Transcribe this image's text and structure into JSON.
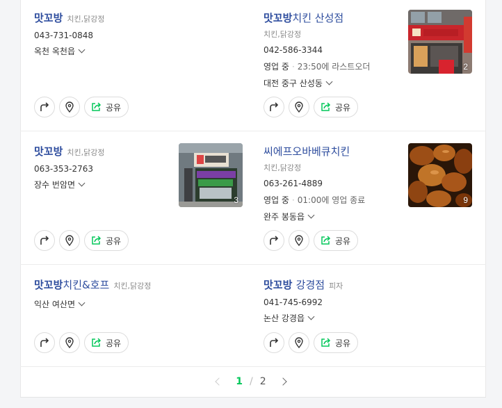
{
  "results": [
    {
      "name": "맛꼬방",
      "name_sub": "",
      "category": "치킨,닭강정",
      "phone": "043-731-0848",
      "status": "",
      "last_order": "",
      "address": "옥천 옥천읍",
      "photo_count": ""
    },
    {
      "name": "맛꼬방",
      "name_sub": "치킨 산성점",
      "category": "치킨,닭강정",
      "phone": "042-586-3344",
      "status": "영업 중",
      "last_order": "23:50에 라스트오더",
      "address": "대전 중구 산성동",
      "photo_count": "2"
    },
    {
      "name": "맛꼬방",
      "name_sub": "",
      "category": "치킨,닭강정",
      "phone": "063-353-2763",
      "status": "",
      "last_order": "",
      "address": "장수 번암면",
      "photo_count": "3"
    },
    {
      "name": "씨에프오바베큐치킨",
      "name_sub": "",
      "category": "치킨,닭강정",
      "phone": "063-261-4889",
      "status": "영업 중",
      "last_order": "01:00에 영업 종료",
      "address": "완주 봉동읍",
      "photo_count": "9"
    },
    {
      "name": "맛꼬방",
      "name_sub": "치킨&호프",
      "category": "치킨,닭강정",
      "phone": "",
      "status": "",
      "last_order": "",
      "address": "익산 여산면",
      "photo_count": ""
    },
    {
      "name": "맛꼬방",
      "name_sub": "강경점",
      "category": "피자",
      "phone": "041-745-6992",
      "status": "",
      "last_order": "",
      "address": "논산 강경읍",
      "photo_count": ""
    }
  ],
  "actions": {
    "share_label": "공유"
  },
  "pagination": {
    "current": "1",
    "separator": "/",
    "total": "2"
  },
  "icons": {
    "directions": "directions-arrow-icon",
    "location": "location-pin-icon",
    "share": "share-arrow-icon",
    "prev": "chevron-left-icon",
    "next": "chevron-right-icon"
  },
  "colors": {
    "title": "#2e4d9e",
    "accent": "#03c75a"
  }
}
